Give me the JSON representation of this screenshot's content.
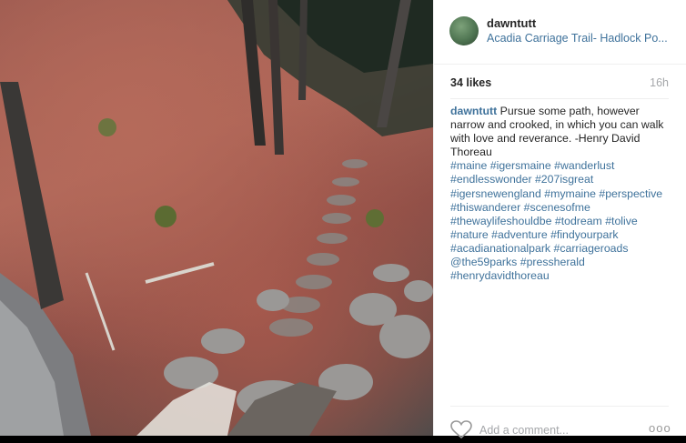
{
  "post": {
    "username": "dawntutt",
    "location": "Acadia Carriage Trail- Hadlock Po...",
    "likes": "34 likes",
    "time_ago": "16h",
    "caption_user": "dawntutt",
    "caption_text": "Pursue some path, however narrow and crooked, in which you can walk with love and reverance. -Henry David Thoreau",
    "hashtag_lines": [
      "#maine #igersmaine #wanderlust",
      "#endlesswonder #207isgreat",
      "#igersnewengland #mymaine #perspective",
      "#thiswanderer #scenesofme",
      "#thewaylifeshouldbe #todream #tolive",
      "#nature #adventure #findyourpark",
      "#acadianationalpark #carriageroads",
      "@the59parks #pressherald",
      "#henrydavidthoreau"
    ],
    "comment_placeholder": "Add a comment...",
    "more_label": "ooo"
  },
  "colors": {
    "link": "#3f729b",
    "text": "#262626",
    "muted": "#a5a7aa",
    "divider": "#efefef"
  },
  "icons": {
    "heart": "heart-icon",
    "more": "more-options-icon"
  }
}
